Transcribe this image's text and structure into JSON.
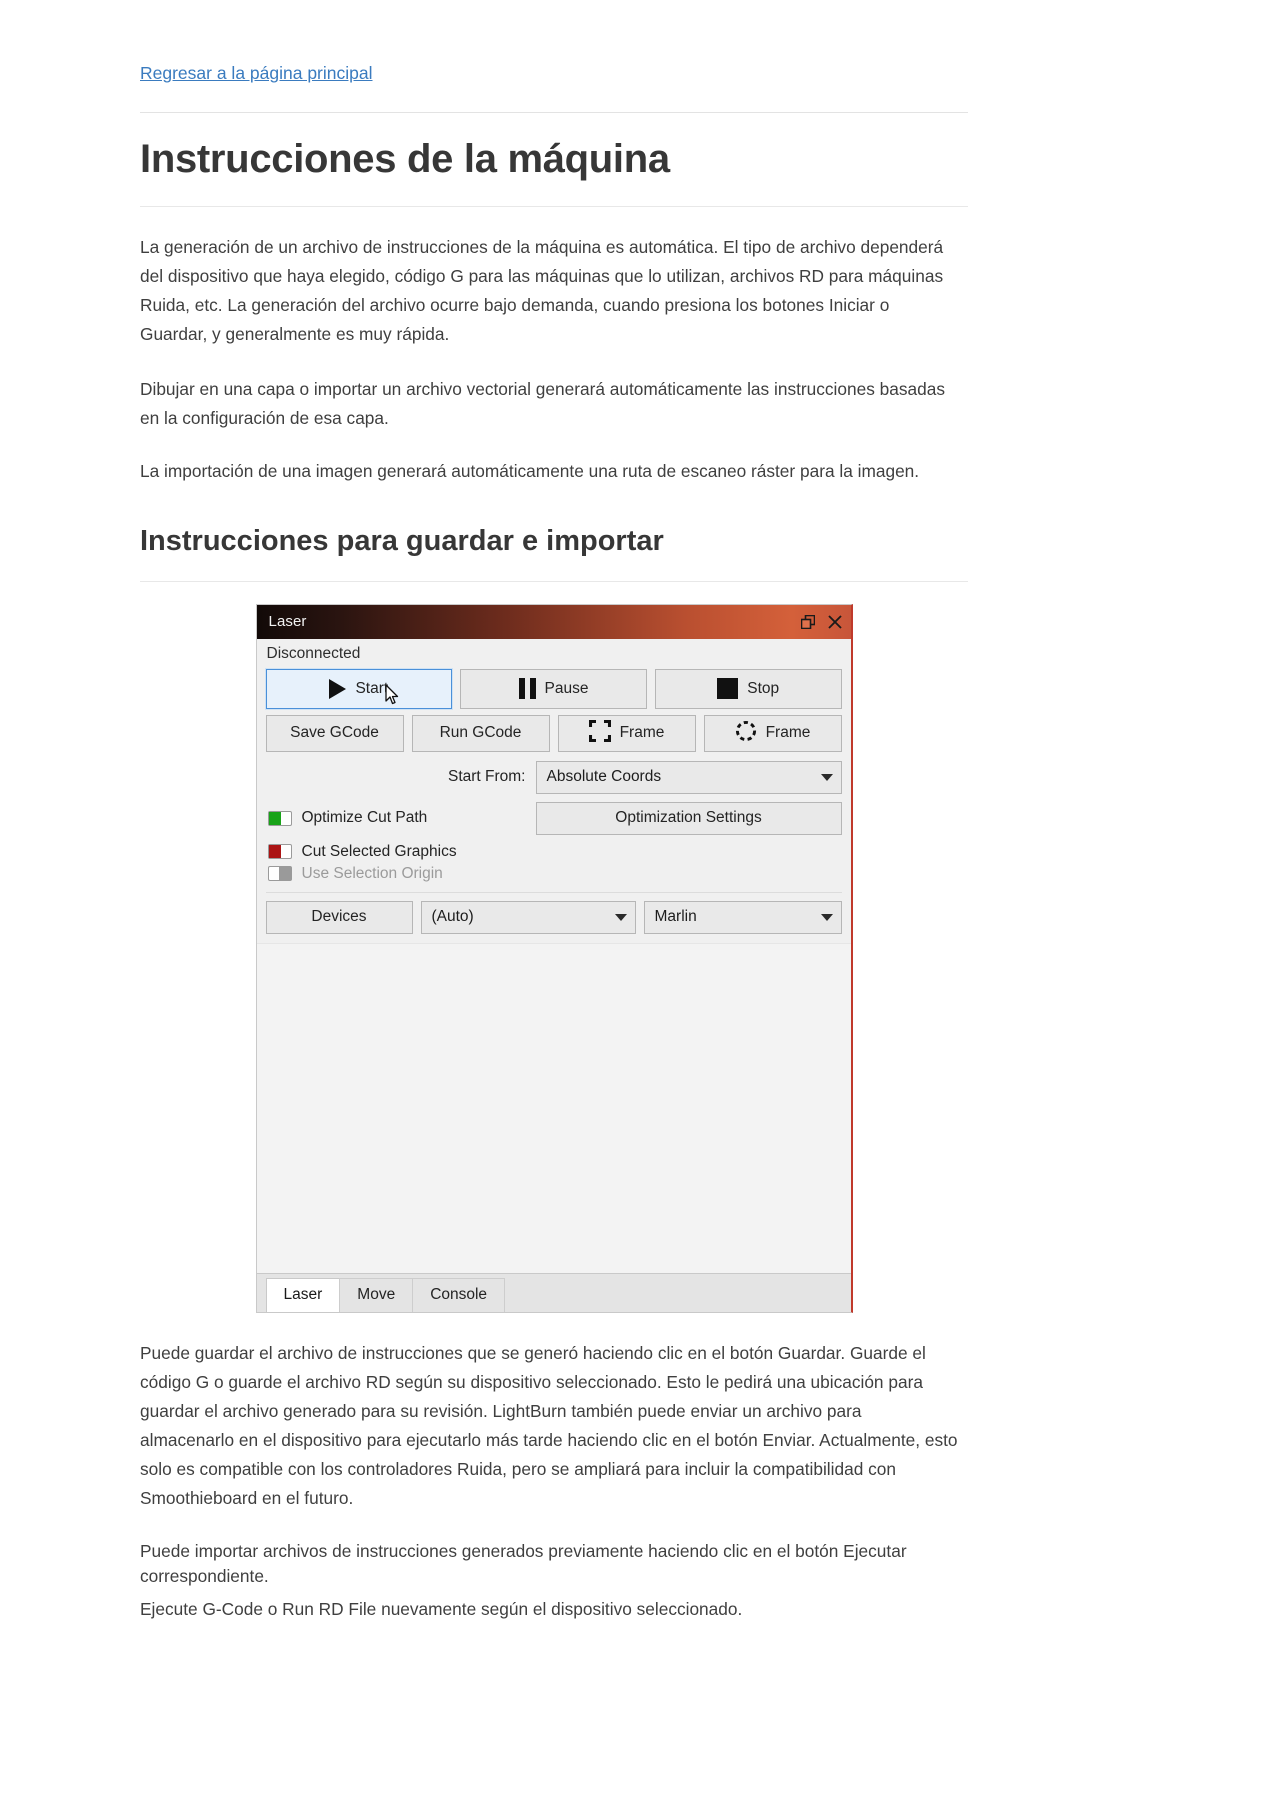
{
  "nav": {
    "back_link": "Regresar a la página principal"
  },
  "article": {
    "title": "Instrucciones de la máquina",
    "paragraphs": [
      "La generación de un archivo de instrucciones de la máquina es automática. El tipo de archivo dependerá del dispositivo que haya elegido, código G para las máquinas que lo utilizan, archivos RD para máquinas Ruida, etc. La generación del archivo ocurre bajo demanda, cuando presiona los botones Iniciar o Guardar, y generalmente es muy rápida.",
      "Dibujar en una capa o importar un archivo vectorial generará automáticamente las instrucciones basadas en la configuración de esa capa.",
      "La importación de una imagen generará automáticamente una ruta de escaneo ráster para la imagen."
    ],
    "subtitle": "Instrucciones para guardar e importar",
    "paragraphs_after": [
      "Puede guardar el archivo de instrucciones que se generó haciendo clic en el botón Guardar. Guarde el código G o guarde el archivo RD según su dispositivo seleccionado. Esto le pedirá una ubicación para guardar el archivo generado para su revisión. LightBurn también puede enviar un archivo para almacenarlo en el dispositivo para ejecutarlo más tarde haciendo clic en el botón Enviar. Actualmente, esto solo es compatible con los controladores Ruida, pero se ampliará para incluir la compatibilidad con Smoothieboard en el futuro.",
      "Puede importar archivos de instrucciones generados previamente haciendo clic en el botón Ejecutar correspondiente.",
      "Ejecute G-Code o Run RD File nuevamente según el dispositivo seleccionado."
    ]
  },
  "laser_panel": {
    "title": "Laser",
    "window_icons": [
      "float-window-icon",
      "close-icon"
    ],
    "status": "Disconnected",
    "primary_buttons": [
      {
        "label": "Start",
        "icon": "play-icon",
        "focused": true
      },
      {
        "label": "Pause",
        "icon": "pause-icon",
        "focused": false
      },
      {
        "label": "Stop",
        "icon": "stop-icon",
        "focused": false
      }
    ],
    "secondary_buttons": [
      {
        "label": "Save GCode",
        "icon": ""
      },
      {
        "label": "Run GCode",
        "icon": ""
      },
      {
        "label": "Frame",
        "icon": "frame-square-icon"
      },
      {
        "label": "Frame",
        "icon": "frame-dashed-icon"
      }
    ],
    "start_from": {
      "label": "Start From:",
      "value": "Absolute Coords"
    },
    "options": [
      {
        "label": "Optimize Cut Path",
        "state": "on-green",
        "disabled": false
      },
      {
        "label": "Cut Selected Graphics",
        "state": "on-red",
        "disabled": false
      },
      {
        "label": "Use Selection Origin",
        "state": "off",
        "disabled": true
      }
    ],
    "optimization_settings_label": "Optimization Settings",
    "devices": {
      "button_label": "Devices",
      "port_value": "(Auto)",
      "profile_value": "Marlin"
    },
    "tabs": [
      {
        "label": "Laser",
        "active": true
      },
      {
        "label": "Move",
        "active": false
      },
      {
        "label": "Console",
        "active": false
      }
    ]
  },
  "colors": {
    "link": "#3a7bbf",
    "titlebar_accent": "#c8563a",
    "toggle_on": "#19a319",
    "toggle_red": "#ab1414",
    "focus_border": "#4a90d9"
  }
}
